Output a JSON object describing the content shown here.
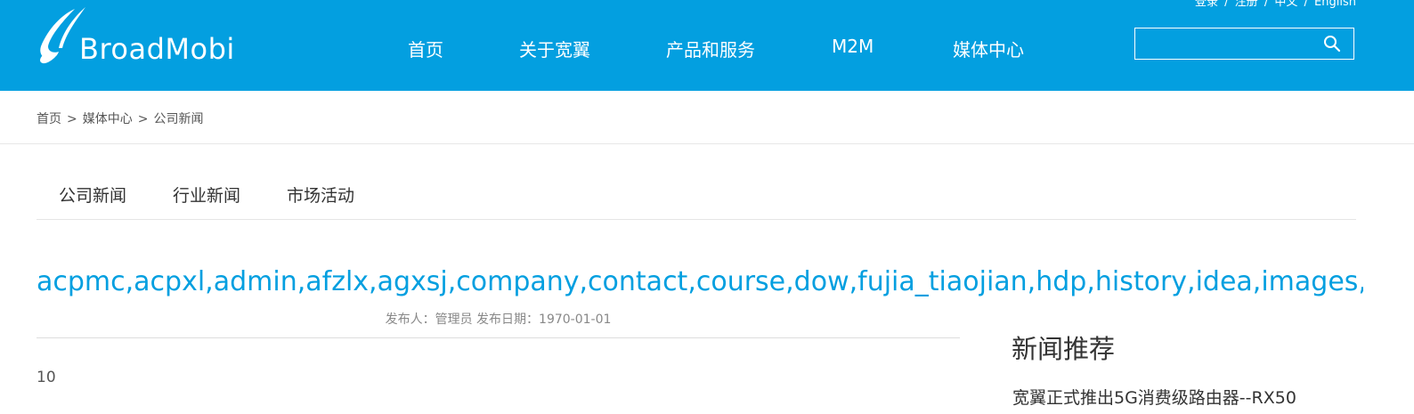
{
  "header": {
    "top_links": [
      "登录",
      "注册",
      "中文",
      "English"
    ],
    "top_link_separator": "/",
    "logo_text": "BroadMobi",
    "nav": [
      "首页",
      "关于宽翼",
      "产品和服务",
      "M2M",
      "媒体中心"
    ],
    "search": {
      "placeholder": "",
      "value": ""
    }
  },
  "breadcrumb": {
    "items": [
      "首页",
      "媒体中心",
      "公司新闻"
    ],
    "separator": ">"
  },
  "subtabs": [
    "公司新闻",
    "行业新闻",
    "市场活动"
  ],
  "article": {
    "title": "acpmc,acpxl,admin,afzlx,agxsj,company,contact,course,dow,fujia_tiaojian,hdp,history,idea,images,investor",
    "meta": "发布人：管理员 发布日期：1970-01-01",
    "body": "10"
  },
  "sidebar": {
    "title": "新闻推荐",
    "items": [
      "宽翼正式推出5G消费级路由器--RX50"
    ]
  },
  "colors": {
    "brand_blue": "#039fe0",
    "text_dark": "#333333",
    "text_muted": "#888888"
  }
}
